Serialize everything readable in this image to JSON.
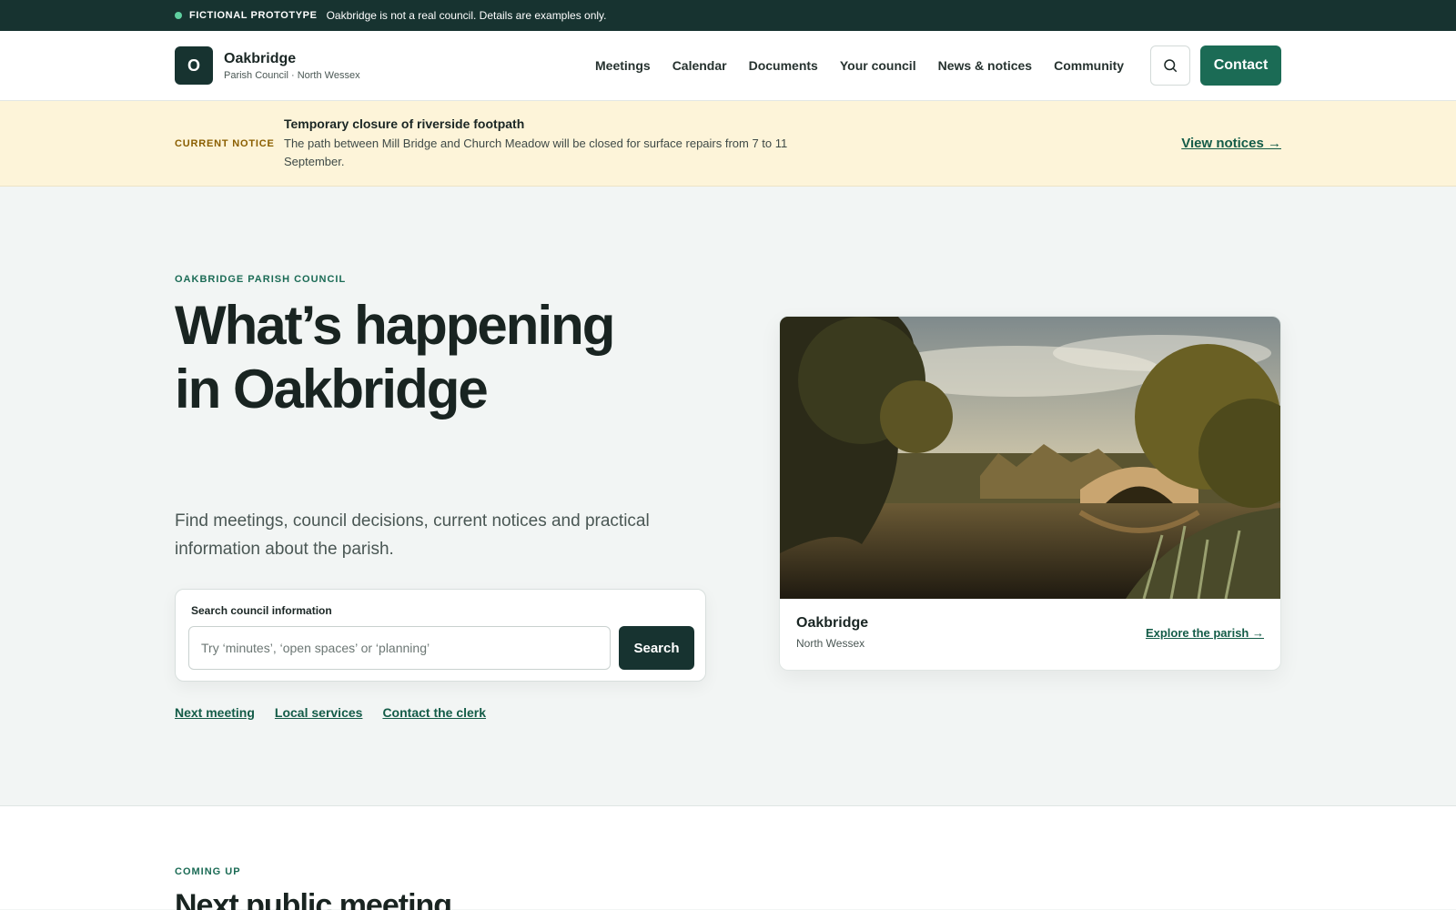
{
  "banner": {
    "tag": "FICTIONAL PROTOTYPE",
    "text": "Oakbridge is not a real council. Details are examples only."
  },
  "header": {
    "logo_letter": "O",
    "brand_name": "Oakbridge",
    "brand_sub": "Parish Council · North Wessex",
    "nav": [
      "Meetings",
      "Calendar",
      "Documents",
      "Your council",
      "News & notices",
      "Community"
    ],
    "contact_label": "Contact",
    "search_icon": "search-icon"
  },
  "notice": {
    "tag": "CURRENT NOTICE",
    "title": "Temporary closure of riverside footpath",
    "body": "The path between Mill Bridge and Church Meadow will be closed for surface repairs from 7 to 11 September.",
    "link": "View notices →"
  },
  "hero": {
    "eyebrow": "OAKBRIDGE PARISH COUNCIL",
    "title": "What’s happening in Oakbridge",
    "lede": "Find meetings, council decisions, current notices and practical information about the parish.",
    "search": {
      "label": "Search council information",
      "placeholder": "Try ‘minutes’, ‘open spaces’ or ‘planning’",
      "button": "Search"
    },
    "quick_links": [
      "Next meeting",
      "Local services",
      "Contact the clerk"
    ],
    "photo_card": {
      "name": "Oakbridge",
      "sub": "North Wessex",
      "link": "Explore the parish →"
    }
  },
  "upcoming": {
    "eyebrow": "COMING UP",
    "title": "Next public meeting"
  },
  "colors": {
    "brand_dark": "#173330",
    "accent_green": "#1b6b55",
    "notice_bg": "#fdf4d9",
    "notice_tag": "#8a5e00"
  }
}
